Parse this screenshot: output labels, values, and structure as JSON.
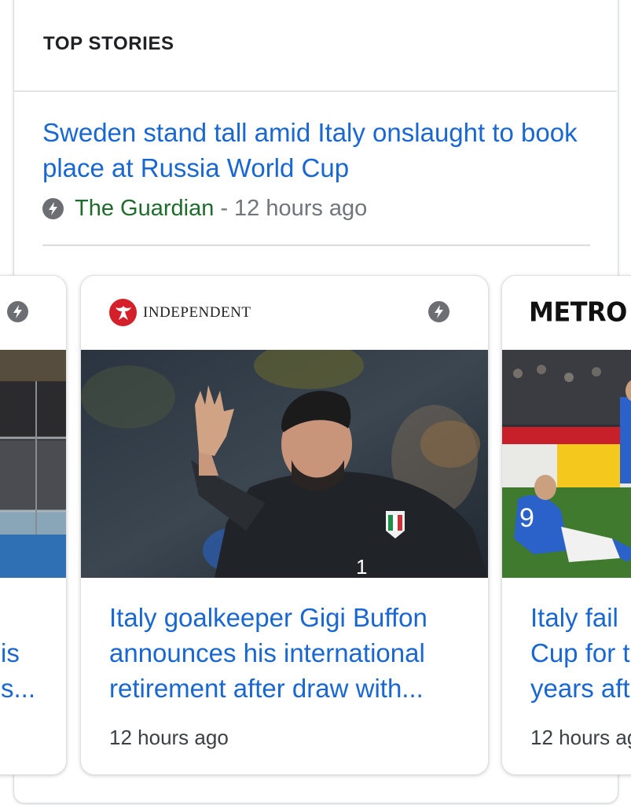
{
  "section": {
    "title": "TOP STORIES"
  },
  "top_story": {
    "headline": "Sweden stand tall amid Italy onslaught to book place at Russia World Cup",
    "source": "The Guardian",
    "separator": "-",
    "time": "12 hours ago",
    "amp_icon": "amp-lightning-icon"
  },
  "carousel": [
    {
      "title_lines": [
        "is",
        "s..."
      ],
      "time": "",
      "image": "stadium-photo"
    },
    {
      "publisher": "INDEPENDENT",
      "publisher_logo": "eagle-logo-icon",
      "title_lines": [
        "Italy goalkeeper Gigi Buffon",
        "announces his international",
        "retirement after draw with..."
      ],
      "time": "12 hours ago",
      "image": "goalkeeper-waving-photo"
    },
    {
      "publisher": "METRO",
      "title_lines": [
        "Italy fail",
        "Cup for t",
        "years aft"
      ],
      "time": "12 hours ag",
      "image": "player-sitting-on-pitch-photo"
    }
  ],
  "colors": {
    "link": "#1967d2",
    "source": "#1e6b2c",
    "muted": "#70757a",
    "independent_red": "#d4202a"
  }
}
